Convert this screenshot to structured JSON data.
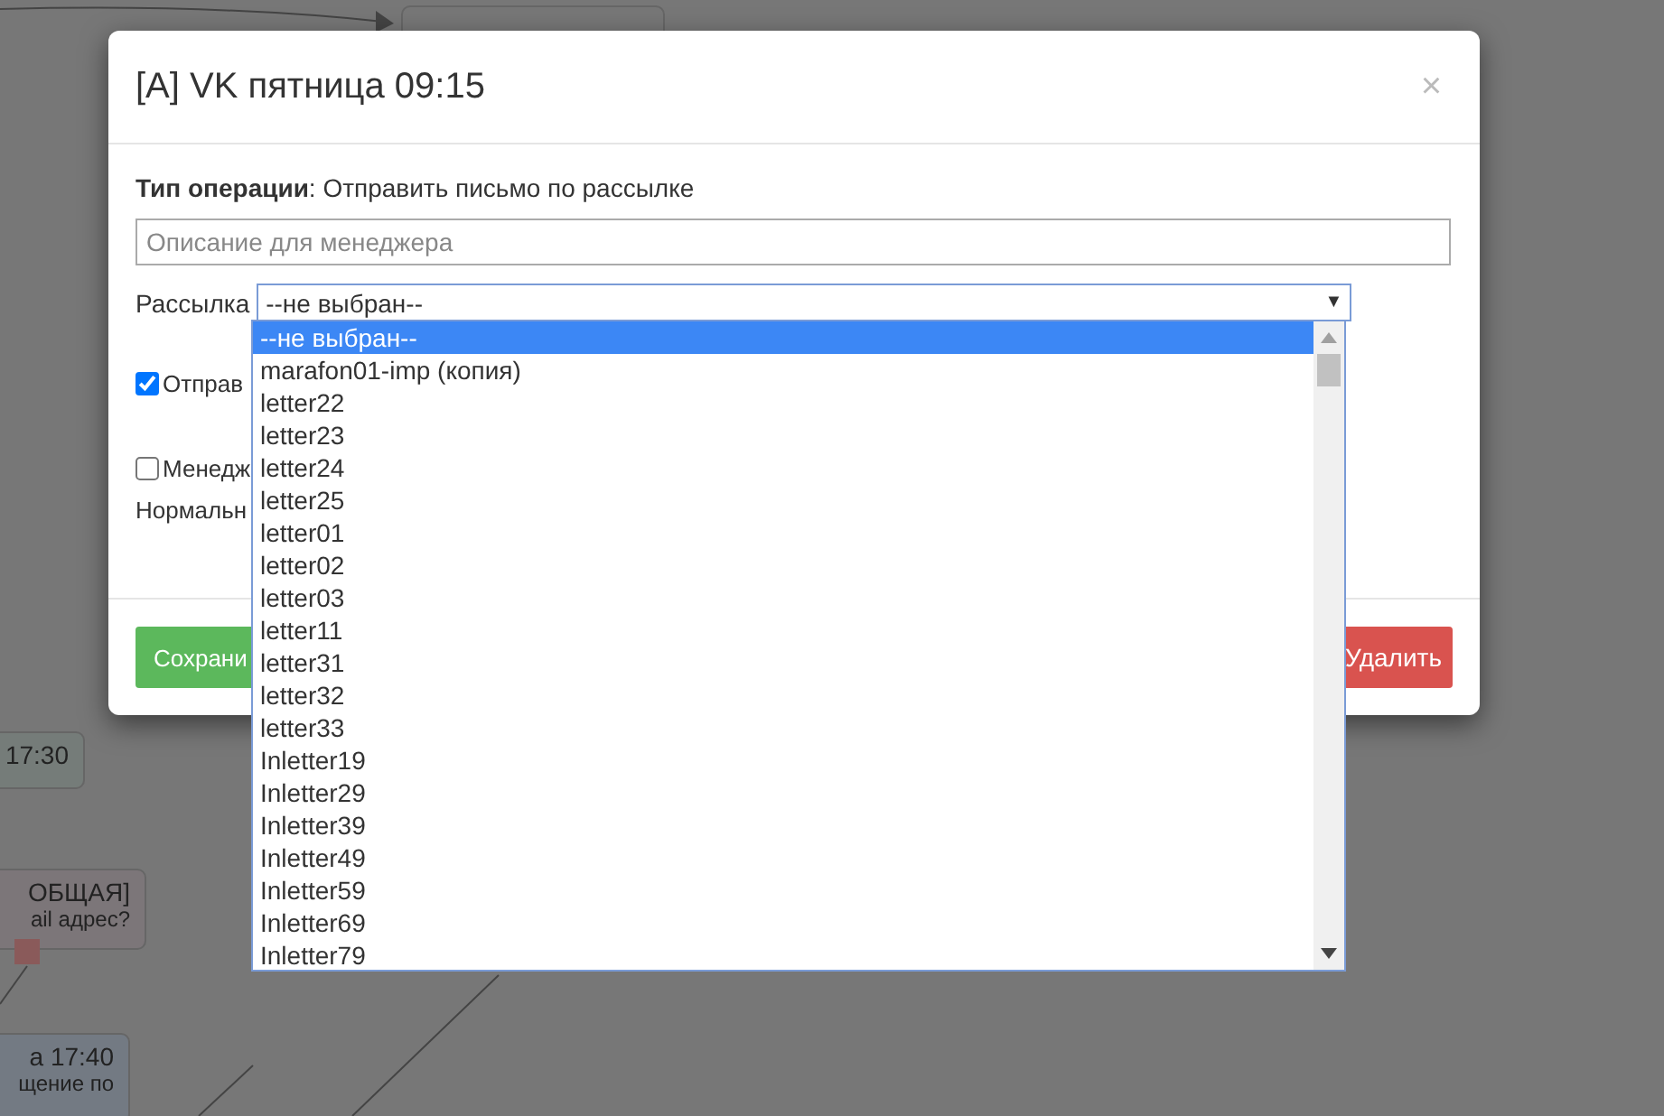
{
  "background_nodes": [
    {
      "lines": [
        "17:30"
      ],
      "color": "#757c79"
    },
    {
      "lines": [
        "ОБЩАЯ]",
        "ail адрес?"
      ],
      "color": "#7c7679"
    },
    {
      "lines": [
        "а 17:40",
        "щение по"
      ],
      "color": "#737a83"
    }
  ],
  "dialog": {
    "title": "[A] VK пятница 09:15",
    "close": "×",
    "operation": "**Тип операции**: Отправить письмо по рассылке",
    "description": {
      "placeholder": "Описание для менеджера"
    },
    "mailing": {
      "label": "Рассылка",
      "value": "--не выбран--",
      "caret": "▼",
      "options": [
        {
          "label": "--не выбран--",
          "selected": true
        },
        {
          "label": "marafon01-imp (копия)",
          "selected": false
        },
        {
          "label": "letter22",
          "selected": false
        },
        {
          "label": "letter23",
          "selected": false
        },
        {
          "label": "letter24",
          "selected": false
        },
        {
          "label": "letter25",
          "selected": false
        },
        {
          "label": "letter01",
          "selected": false
        },
        {
          "label": "letter02",
          "selected": false
        },
        {
          "label": "letter03",
          "selected": false
        },
        {
          "label": "letter11",
          "selected": false
        },
        {
          "label": "letter31",
          "selected": false
        },
        {
          "label": "letter32",
          "selected": false
        },
        {
          "label": "letter33",
          "selected": false
        },
        {
          "label": "Inletter19",
          "selected": false
        },
        {
          "label": "Inletter29",
          "selected": false
        },
        {
          "label": "Inletter39",
          "selected": false
        },
        {
          "label": "Inletter49",
          "selected": false
        },
        {
          "label": "Inletter59",
          "selected": false
        },
        {
          "label": "Inletter69",
          "selected": false
        },
        {
          "label": "Inletter79",
          "selected": false
        }
      ]
    },
    "checkboxes": [
      {
        "label": "Отправ",
        "checked": true
      },
      {
        "label": "Менедж",
        "checked": false
      }
    ],
    "note": "Нормальн",
    "buttons": [
      {
        "label": "Сохрани",
        "kind": "save"
      },
      {
        "label": "Удалить",
        "kind": "delete"
      }
    ]
  }
}
